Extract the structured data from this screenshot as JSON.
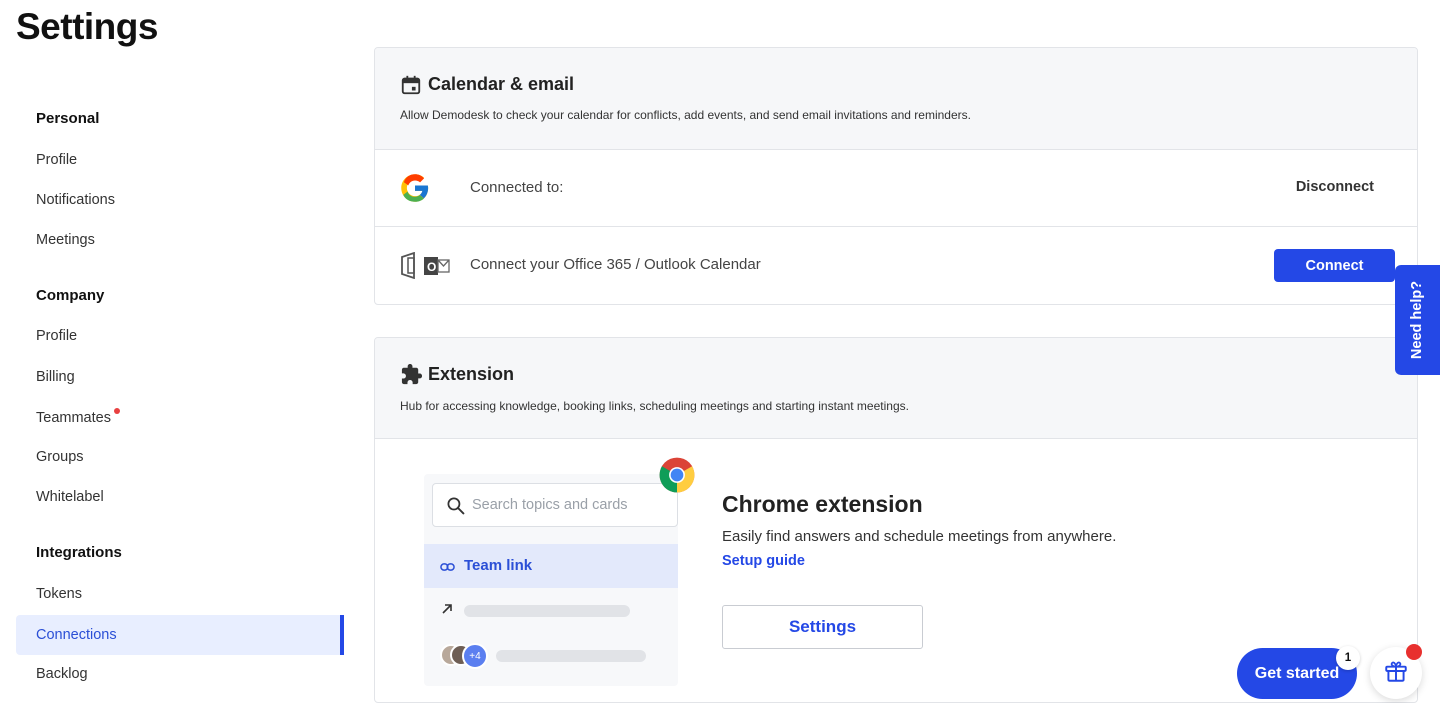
{
  "page": {
    "title": "Settings"
  },
  "sidebar": {
    "groups": [
      {
        "title": "Personal",
        "items": [
          {
            "label": "Profile"
          },
          {
            "label": "Notifications"
          },
          {
            "label": "Meetings"
          }
        ]
      },
      {
        "title": "Company",
        "items": [
          {
            "label": "Profile"
          },
          {
            "label": "Billing"
          },
          {
            "label": "Teammates",
            "badge": "red-dot"
          },
          {
            "label": "Groups"
          },
          {
            "label": "Whitelabel"
          }
        ]
      },
      {
        "title": "Integrations",
        "items": [
          {
            "label": "Tokens"
          },
          {
            "label": "Connections",
            "active": true
          },
          {
            "label": "Backlog"
          }
        ]
      }
    ]
  },
  "calendar_card": {
    "icon": "calendar-icon",
    "title": "Calendar & email",
    "description": "Allow Demodesk to check your calendar for conflicts, add events, and send email invitations and reminders.",
    "google": {
      "icon": "google-icon",
      "text": "Connected to:",
      "action": "Disconnect"
    },
    "outlook": {
      "icon": "outlook-icon",
      "text": "Connect your Office 365 / Outlook Calendar",
      "action": "Connect"
    }
  },
  "extension_card": {
    "icon": "puzzle-icon",
    "title": "Extension",
    "description": "Hub for accessing knowledge, booking links, scheduling meetings and starting instant meetings.",
    "preview": {
      "search_placeholder": "Search topics and cards",
      "team_link": "Team link",
      "avatars_more": "+4"
    },
    "chrome": {
      "title": "Chrome extension",
      "description": "Easily find answers and schedule meetings from anywhere.",
      "setup_guide": "Setup guide",
      "settings_button": "Settings"
    }
  },
  "floating": {
    "need_help": "Need help?",
    "get_started": "Get started",
    "get_started_badge": "1"
  },
  "colors": {
    "accent": "#2448e6",
    "active_bg": "#e8eeff",
    "notification": "#e8302e"
  }
}
